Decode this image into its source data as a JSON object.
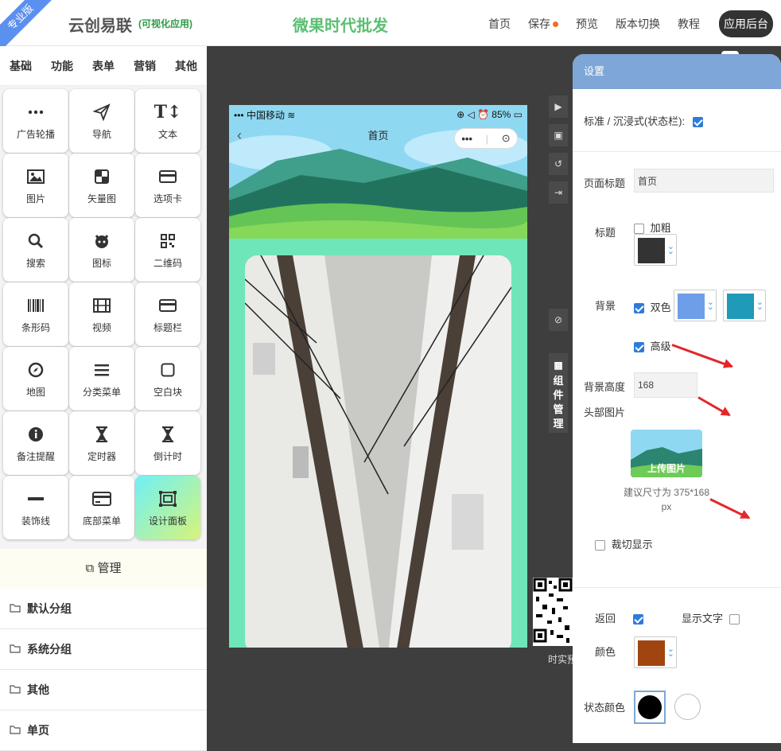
{
  "header": {
    "ribbon": "专业版",
    "brand": "云创易联",
    "brand_sub": "(可视化应用)",
    "store_name": "微果时代批发",
    "nav": [
      "首页",
      "保存",
      "预览",
      "版本切换",
      "教程"
    ],
    "admin_label": "应用后台"
  },
  "sidebar": {
    "categories": [
      "基础",
      "功能",
      "表单",
      "营销",
      "其他"
    ],
    "components": [
      {
        "label": "广告轮播",
        "icon": "ellipsis-icon"
      },
      {
        "label": "导航",
        "icon": "paper-plane-icon"
      },
      {
        "label": "文本",
        "icon": "text-size-icon"
      },
      {
        "label": "图片",
        "icon": "image-icon"
      },
      {
        "label": "矢量图",
        "icon": "vector-icon"
      },
      {
        "label": "选项卡",
        "icon": "card-icon"
      },
      {
        "label": "搜索",
        "icon": "search-icon"
      },
      {
        "label": "图标",
        "icon": "github-icon"
      },
      {
        "label": "二维码",
        "icon": "qrcode-icon"
      },
      {
        "label": "条形码",
        "icon": "barcode-icon"
      },
      {
        "label": "视频",
        "icon": "film-icon"
      },
      {
        "label": "标题栏",
        "icon": "titlebar-icon"
      },
      {
        "label": "地图",
        "icon": "compass-icon"
      },
      {
        "label": "分类菜单",
        "icon": "menu-icon"
      },
      {
        "label": "空白块",
        "icon": "square-icon"
      },
      {
        "label": "备注提醒",
        "icon": "info-icon"
      },
      {
        "label": "定时器",
        "icon": "hourglass-icon"
      },
      {
        "label": "倒计时",
        "icon": "hourglass-icon"
      },
      {
        "label": "装饰线",
        "icon": "line-icon"
      },
      {
        "label": "底部菜单",
        "icon": "card-icon"
      },
      {
        "label": "设计面板",
        "icon": "design-icon"
      }
    ],
    "manage_label": "管理",
    "groups": [
      "默认分组",
      "系统分组",
      "其他",
      "单页"
    ]
  },
  "phone": {
    "carrier": "中国移动",
    "battery": "85%",
    "title": "首页"
  },
  "tools": {
    "component_manager": "组件管理",
    "qr_label": "时实预"
  },
  "settings": {
    "title": "设置",
    "statusbar_label": "标准 / 沉浸式(状态栏):",
    "page_title_label": "页面标题",
    "page_title_value": "首页",
    "title_label": "标题",
    "bold_label": "加粗",
    "title_color": "#333333",
    "bg_label": "背景",
    "dual_label": "双色",
    "bg_color1": "#6f9ee8",
    "bg_color2": "#1f9ab8",
    "advanced_label": "高级",
    "bg_height_label": "背景高度",
    "bg_height_value": "168",
    "header_img_label": "头部图片",
    "upload_label": "上传图片",
    "size_hint": "建议尺寸为 375*168",
    "size_unit": "px",
    "crop_label": "裁切显示",
    "back_label": "返回",
    "show_text_label": "显示文字",
    "color_label": "颜色",
    "back_color": "#a0450f",
    "status_color_label": "状态颜色"
  }
}
